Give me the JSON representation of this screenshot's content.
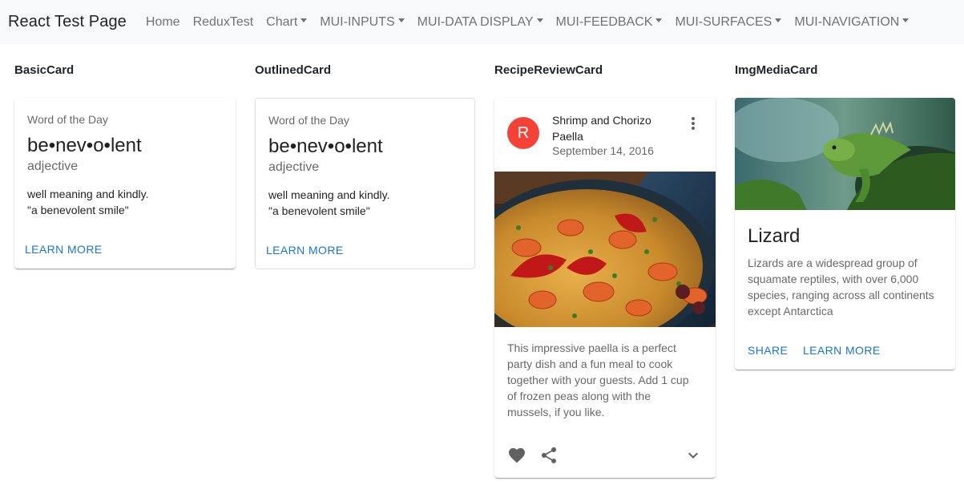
{
  "navbar": {
    "brand": "React Test Page",
    "items": [
      {
        "label": "Home"
      },
      {
        "label": "ReduxTest"
      },
      {
        "label": "Chart"
      },
      {
        "label": "MUI-INPUTS"
      },
      {
        "label": "MUI-DATA DISPLAY"
      },
      {
        "label": "MUI-FEEDBACK"
      },
      {
        "label": "MUI-SURFACES"
      },
      {
        "label": "MUI-NAVIGATION"
      }
    ]
  },
  "sections": {
    "basic": "BasicCard",
    "outlined": "OutlinedCard",
    "recipe": "RecipeReviewCard",
    "img": "ImgMediaCard"
  },
  "word_card": {
    "overline": "Word of the Day",
    "word": "be•nev•o•lent",
    "part_of_speech": "adjective",
    "definition": "well meaning and kindly.",
    "example": "\"a benevolent smile\"",
    "action": "LEARN MORE"
  },
  "recipe_card": {
    "avatar_letter": "R",
    "title_line1": "Shrimp and Chorizo",
    "title_line2": "Paella",
    "date": "September 14, 2016",
    "body_lines": [
      "This impressive paella is a perfect",
      "party dish and a fun meal to cook",
      "together with your guests. Add 1 cup",
      "of frozen peas along with the",
      "mussels, if you like."
    ],
    "icons": {
      "more": "more-vert-icon",
      "favorite": "heart-icon",
      "share": "share-icon",
      "expand": "chevron-down-icon"
    }
  },
  "media_card": {
    "title": "Lizard",
    "body_lines": [
      "Lizards are a widespread group of",
      "squamate reptiles, with over 6,000",
      "species, ranging across all continents",
      "except Antarctica"
    ],
    "action_share": "SHARE",
    "action_learn": "LEARN MORE"
  },
  "colors": {
    "avatar": "#f44336",
    "primary": "#1976d2",
    "navbar_bg": "#f8f9fa"
  }
}
